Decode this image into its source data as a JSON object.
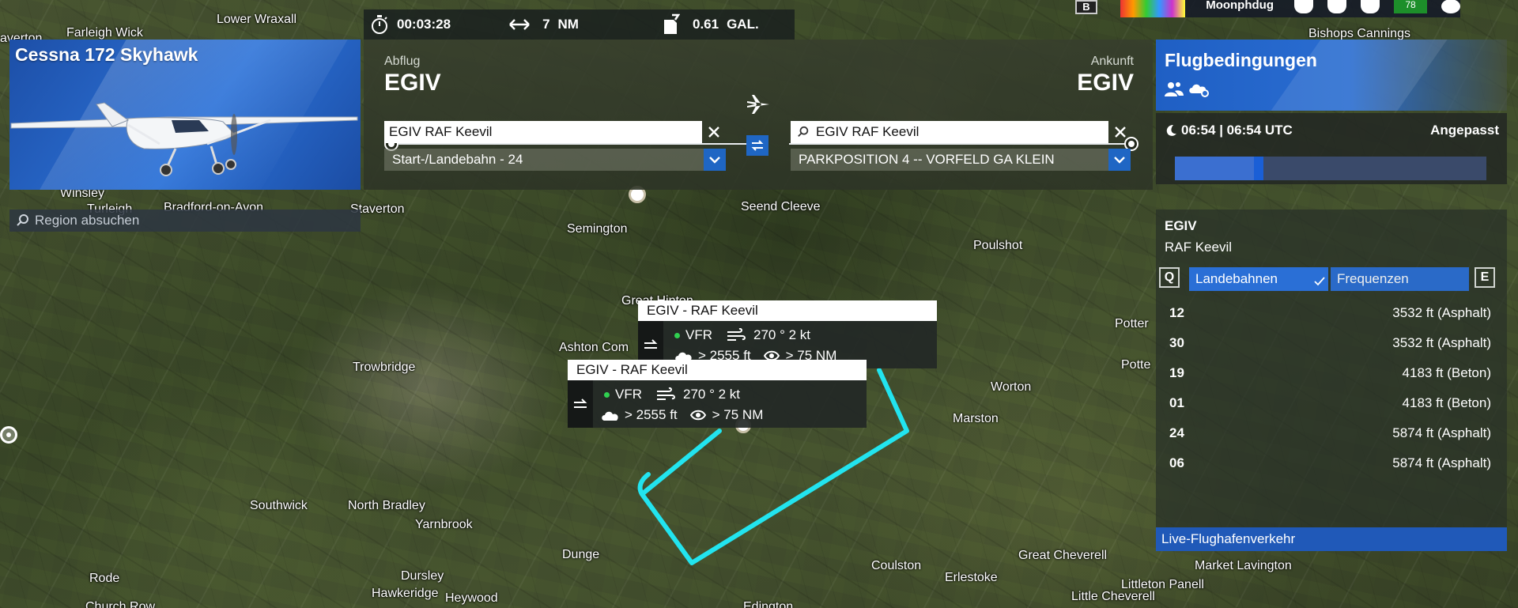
{
  "top_bar": {
    "timer": "00:03:28",
    "distance": "7",
    "distance_unit": "NM",
    "fuel": "0.61",
    "fuel_unit": "GAL.",
    "key_b": "B",
    "username": "Moonphdug",
    "badge": "78"
  },
  "aircraft": {
    "name": "Cessna 172 Skyhawk"
  },
  "region_search": {
    "placeholder": "Region absuchen"
  },
  "departure": {
    "label": "Abflug",
    "code": "EGIV",
    "search_value": "EGIV RAF Keevil",
    "runway": "Start-/Landebahn - 24"
  },
  "arrival": {
    "label": "Ankunft",
    "code": "EGIV",
    "search_value": "EGIV RAF Keevil",
    "parking": "PARKPOSITION 4 -- VORFELD GA KLEIN"
  },
  "conditions": {
    "title": "Flugbedingungen",
    "time": "06:54 | 06:54 UTC",
    "mode": "Angepasst",
    "time_progress": 0.27
  },
  "airport": {
    "code": "EGIV",
    "name": "RAF Keevil",
    "key_left": "Q",
    "key_right": "E",
    "tab_runways": "Landebahnen",
    "tab_frequencies": "Frequenzen",
    "runways": [
      {
        "id": "12",
        "length": "3532  ft (Asphalt)"
      },
      {
        "id": "30",
        "length": "3532  ft (Asphalt)"
      },
      {
        "id": "19",
        "length": "4183  ft (Beton)"
      },
      {
        "id": "01",
        "length": "4183  ft (Beton)"
      },
      {
        "id": "24",
        "length": "5874  ft (Asphalt)"
      },
      {
        "id": "06",
        "length": "5874  ft (Asphalt)"
      }
    ],
    "live_traffic": "Live-Flughafenverkehr"
  },
  "popups": [
    {
      "title": "EGIV - RAF Keevil",
      "rules": "VFR",
      "wind": "270 ° 2 kt",
      "ceiling": "> 2555  ft",
      "visibility": "> 75  NM"
    },
    {
      "title": "EGIV - RAF Keevil",
      "rules": "VFR",
      "wind": "270 ° 2 kt",
      "ceiling": "> 2555  ft",
      "visibility": "> 75  NM"
    }
  ],
  "map_labels": {
    "farleigh_wick": "Farleigh Wick",
    "lower_wraxall": "Lower Wraxall",
    "averton": "averton",
    "bishops_cannings": "Bishops Cannings",
    "winsley": "Winsley",
    "turleigh": "Turleigh",
    "bradford": "Bradford-on-Avon",
    "staverton": "Staverton",
    "staverton2": "Staverton",
    "seend_cleeve": "Seend Cleeve",
    "semington": "Semington",
    "poulshot": "Poulshot",
    "great_hinton": "Great Hinton",
    "ashton_common": "Ashton Com",
    "trowbridge": "Trowbridge",
    "potterne": "Potter",
    "potterne2": "Potte",
    "worton": "Worton",
    "marston": "Marston",
    "southwick": "Southwick",
    "north_bradley": "North Bradley",
    "yarnbrook": "Yarnbrook",
    "dunge": "Dunge",
    "coulston": "Coulston",
    "great_cheverell": "Great Cheverell",
    "market_lavington": "Market Lavington",
    "rode": "Rode",
    "dursley": "Dursley",
    "hawkeridge": "Hawkeridge",
    "heywood": "Heywood",
    "erlestoke": "Erlestoke",
    "littleton_panell": "Littleton Panell",
    "little_cheverell": "Little Cheverell",
    "church_row": "Church Row",
    "edington": "Edington"
  },
  "colors": {
    "route": "#22e4ef",
    "accent_blue": "#2a6fd6",
    "vfr_green": "#30d050"
  }
}
